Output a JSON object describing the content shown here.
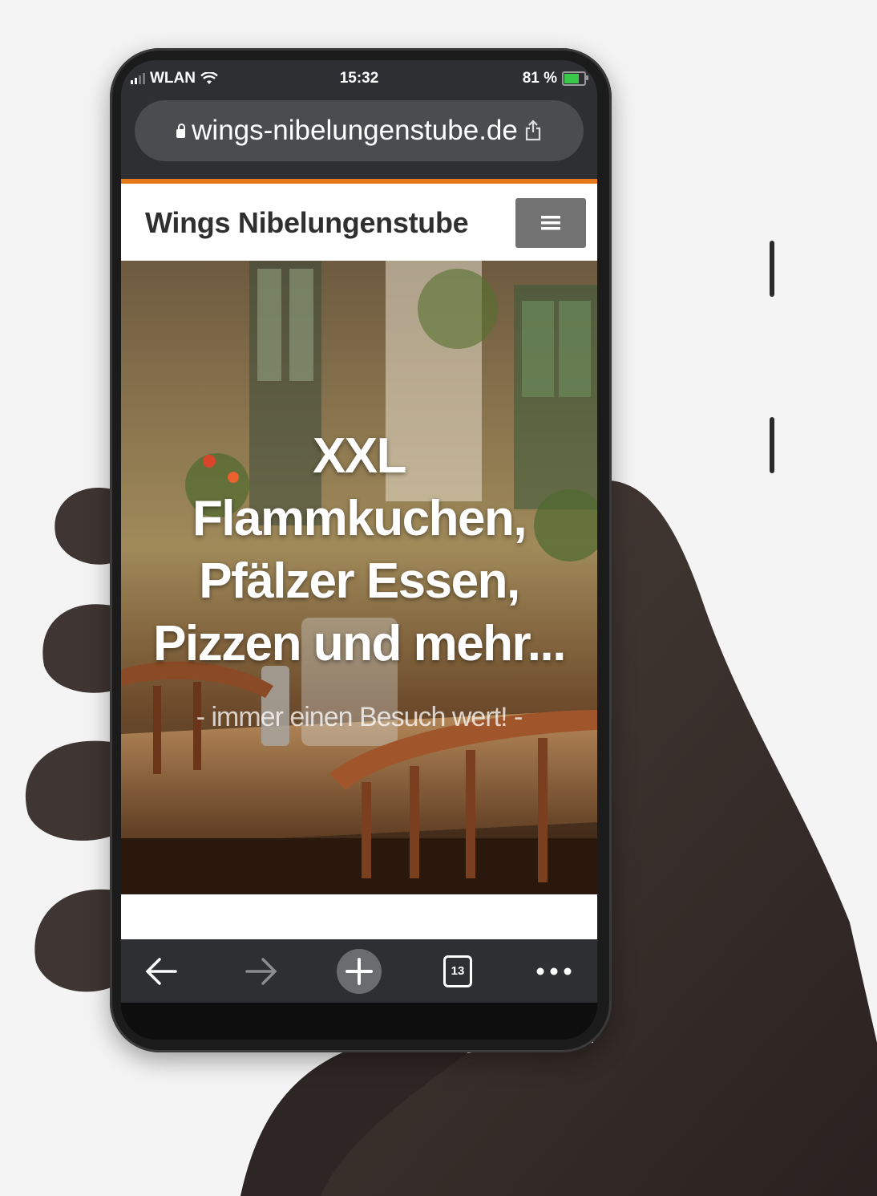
{
  "status_bar": {
    "carrier": "WLAN",
    "time": "15:32",
    "battery_percent": "81 %",
    "battery_level": 0.81,
    "battery_color": "#3ac84a"
  },
  "browser": {
    "url": "wings-nibelungenstube.de",
    "lock_icon": "lock-icon",
    "share_icon": "share-icon",
    "open_tabs": "13",
    "toolbar_icons": [
      "back-arrow-icon",
      "forward-arrow-icon",
      "plus-icon",
      "tabs-icon",
      "more-dots-icon"
    ]
  },
  "site": {
    "accent_color": "#e57a1a",
    "title": "Wings Nibelungenstube",
    "menu_icon": "hamburger-icon",
    "hero": {
      "headline_line1": "XXL",
      "headline_line2": "Flammkuchen,",
      "headline_line3": "Pfälzer Essen,",
      "headline_line4": "Pizzen und mehr...",
      "subline": "- immer einen Besuch wert! -"
    }
  }
}
